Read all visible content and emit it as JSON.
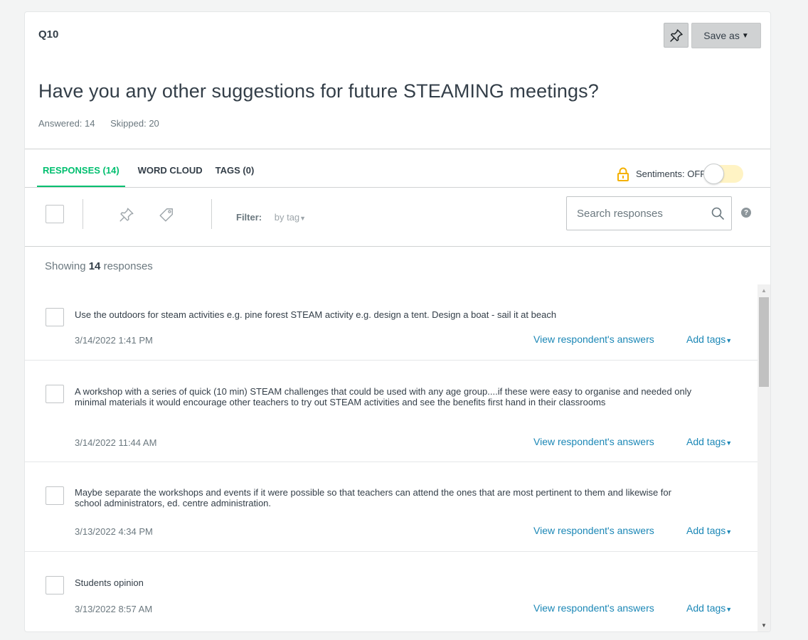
{
  "question": {
    "number": "Q10",
    "title": "Have you any other suggestions for future STEAMING meetings?",
    "answered": "Answered: 14",
    "skipped": "Skipped: 20"
  },
  "header_buttons": {
    "pin_icon": "pin-icon",
    "save_as_label": "Save as"
  },
  "tabs": [
    {
      "label": "RESPONSES (14)",
      "active": true
    },
    {
      "label": "WORD CLOUD",
      "active": false
    },
    {
      "label": "TAGS (0)",
      "active": false
    }
  ],
  "sentiments": {
    "label": "Sentiments: OFF",
    "enabled": false,
    "lock_icon": "lock-icon"
  },
  "toolbar": {
    "filter_label": "Filter:",
    "filter_value": "by tag",
    "search_placeholder": "Search responses",
    "help_label": "?"
  },
  "showing": {
    "prefix": "Showing",
    "count": "14",
    "suffix": "responses"
  },
  "responses": [
    {
      "text": "Use the outdoors for steam activities e.g. pine forest STEAM activity e.g. design a tent. Design a boat - sail it at beach",
      "date": "3/14/2022 1:41 PM",
      "view_label": "View respondent's answers",
      "tags_label": "Add tags"
    },
    {
      "text": "A workshop with a series of quick (10 min) STEAM challenges that could be used with any age group....if these were easy to organise and needed only minimal materials it would encourage other teachers to try out STEAM activities and see the benefits first hand in their classrooms",
      "date": "3/14/2022 11:44 AM",
      "view_label": "View respondent's answers",
      "tags_label": "Add tags"
    },
    {
      "text": "Maybe separate the workshops and events if it were possible so that teachers can attend the ones that are most pertinent to them and likewise for school administrators, ed. centre administration.",
      "date": "3/13/2022 4:34 PM",
      "view_label": "View respondent's answers",
      "tags_label": "Add tags"
    },
    {
      "text": "Students opinion",
      "date": "3/13/2022 8:57 AM",
      "view_label": "View respondent's answers",
      "tags_label": "Add tags"
    }
  ],
  "colors": {
    "accent_green": "#00bf6f",
    "link_blue": "#1b87b6",
    "toggle_yellow": "#fff3c4",
    "lock_yellow": "#f4b100"
  }
}
